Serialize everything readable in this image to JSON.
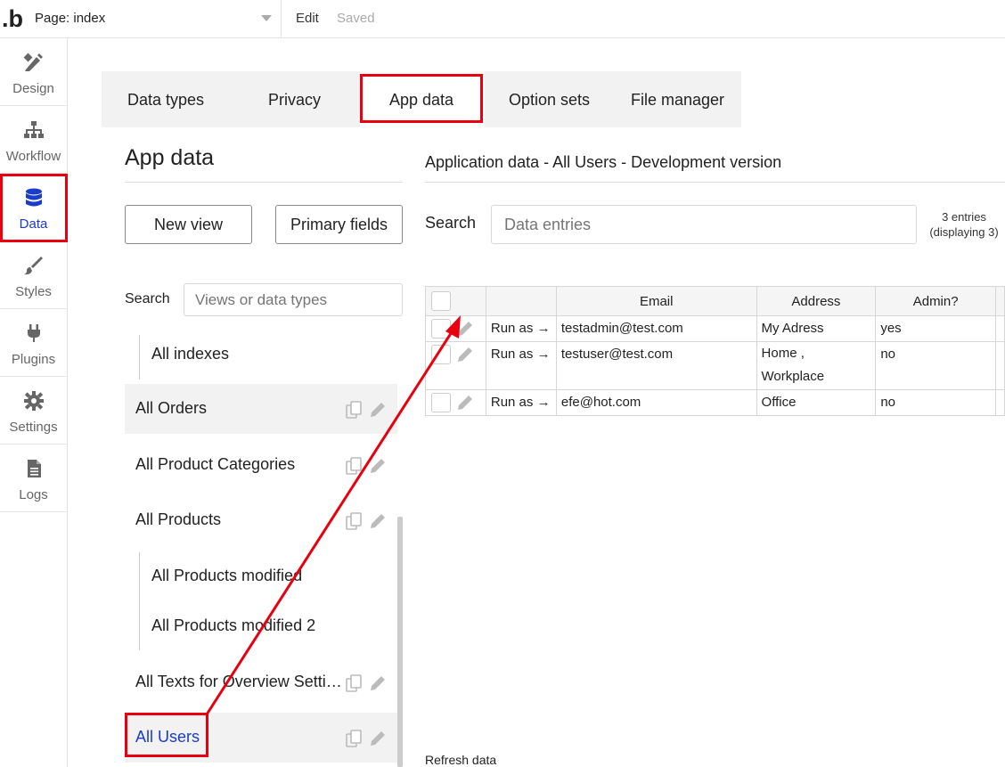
{
  "topbar": {
    "logo": ".b",
    "page_select": "Page: index",
    "edit": "Edit",
    "saved": "Saved"
  },
  "sidebar": {
    "items": [
      {
        "label": "Design",
        "icon": "design-icon"
      },
      {
        "label": "Workflow",
        "icon": "workflow-icon"
      },
      {
        "label": "Data",
        "icon": "database-icon",
        "active": true
      },
      {
        "label": "Styles",
        "icon": "brush-icon"
      },
      {
        "label": "Plugins",
        "icon": "plug-icon"
      },
      {
        "label": "Settings",
        "icon": "gear-icon"
      },
      {
        "label": "Logs",
        "icon": "document-icon"
      }
    ]
  },
  "tabs": [
    "Data types",
    "Privacy",
    "App data",
    "Option sets",
    "File manager"
  ],
  "active_tab": "App data",
  "left_panel": {
    "title": "App data",
    "new_view": "New view",
    "primary_fields": "Primary fields",
    "search_label": "Search",
    "search_placeholder": "Views or data types",
    "views": [
      "All indexes",
      "All Orders",
      "All Product Categories",
      "All Products",
      "All Products modified",
      "All Products modified 2",
      "All Texts for Overview Setti…",
      "All Users"
    ]
  },
  "right_panel": {
    "title": "Application data - All Users - Development version",
    "search_label": "Search",
    "search_placeholder": "Data entries",
    "entries_count": "3 entries",
    "entries_displaying": "(displaying 3)",
    "columns": [
      "Email",
      "Address",
      "Admin?"
    ],
    "run_as": "Run as →",
    "rows": [
      {
        "email": "testadmin@test.com",
        "address": "My Adress",
        "admin": "yes"
      },
      {
        "email": "testuser@test.com",
        "address": "Home ,\nWorkplace",
        "admin": "no"
      },
      {
        "email": "efe@hot.com",
        "address": "Office",
        "admin": "no"
      }
    ],
    "refresh": "Refresh data"
  },
  "colors": {
    "accent": "#1a3cc8",
    "annotation": "#e8000f"
  }
}
